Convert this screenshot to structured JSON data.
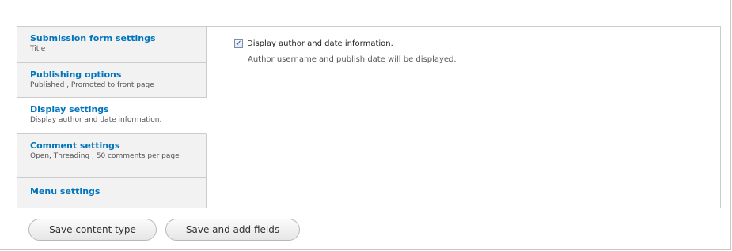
{
  "tabs": [
    {
      "title": "Submission form settings",
      "summary": "Title"
    },
    {
      "title": "Publishing options",
      "summary": "Published , Promoted to front page"
    },
    {
      "title": "Display settings",
      "summary": "Display author and date information."
    },
    {
      "title": "Comment settings",
      "summary": "Open, Threading , 50 comments per page"
    },
    {
      "title": "Menu settings",
      "summary": ""
    }
  ],
  "display_pane": {
    "checkbox_label": "Display author and date information.",
    "checkbox_checked": true,
    "description": "Author username and publish date will be displayed."
  },
  "buttons": {
    "save_content_type": "Save content type",
    "save_and_add_fields": "Save and add fields"
  }
}
